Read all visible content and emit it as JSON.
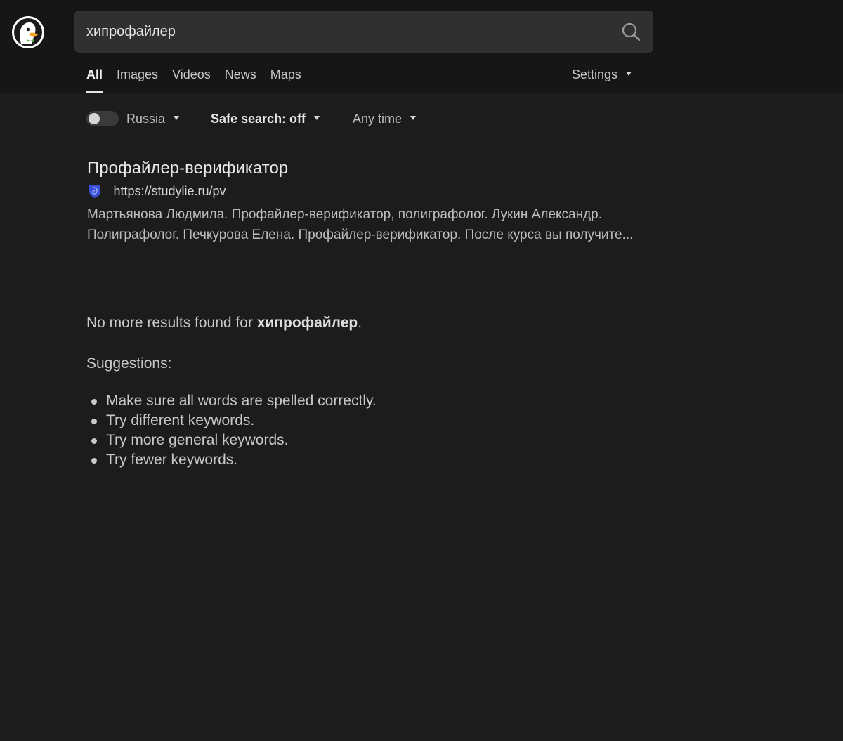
{
  "search": {
    "query": "хипрофайлер"
  },
  "tabs": [
    {
      "label": "All",
      "active": true
    },
    {
      "label": "Images",
      "active": false
    },
    {
      "label": "Videos",
      "active": false
    },
    {
      "label": "News",
      "active": false
    },
    {
      "label": "Maps",
      "active": false
    }
  ],
  "settings_label": "Settings",
  "filters": {
    "region": "Russia",
    "safe_search": "Safe search: off",
    "time": "Any time"
  },
  "results": [
    {
      "title": "Профайлер-верификатор",
      "url": "https://studylie.ru/pv",
      "snippet": "Мартьянова Людмила. Профайлер-верификатор, полиграфолог. Лукин Александр. Полиграфолог. Печкурова Елена. Профайлер-верификатор. После курса вы получите..."
    }
  ],
  "no_more": {
    "prefix": "No more results found for ",
    "query": "хипрофайлер",
    "suffix": "."
  },
  "suggestions": {
    "heading": "Suggestions:",
    "items": [
      "Make sure all words are spelled correctly.",
      "Try different keywords.",
      "Try more general keywords.",
      "Try fewer keywords."
    ]
  },
  "colors": {
    "background": "#1c1c1c",
    "header": "#161616",
    "search_box": "#303030",
    "favicon": "#3b4fd6"
  },
  "icons": {
    "logo": "duck-logo-icon",
    "search": "search-icon",
    "favicon": "site-favicon-icon"
  }
}
